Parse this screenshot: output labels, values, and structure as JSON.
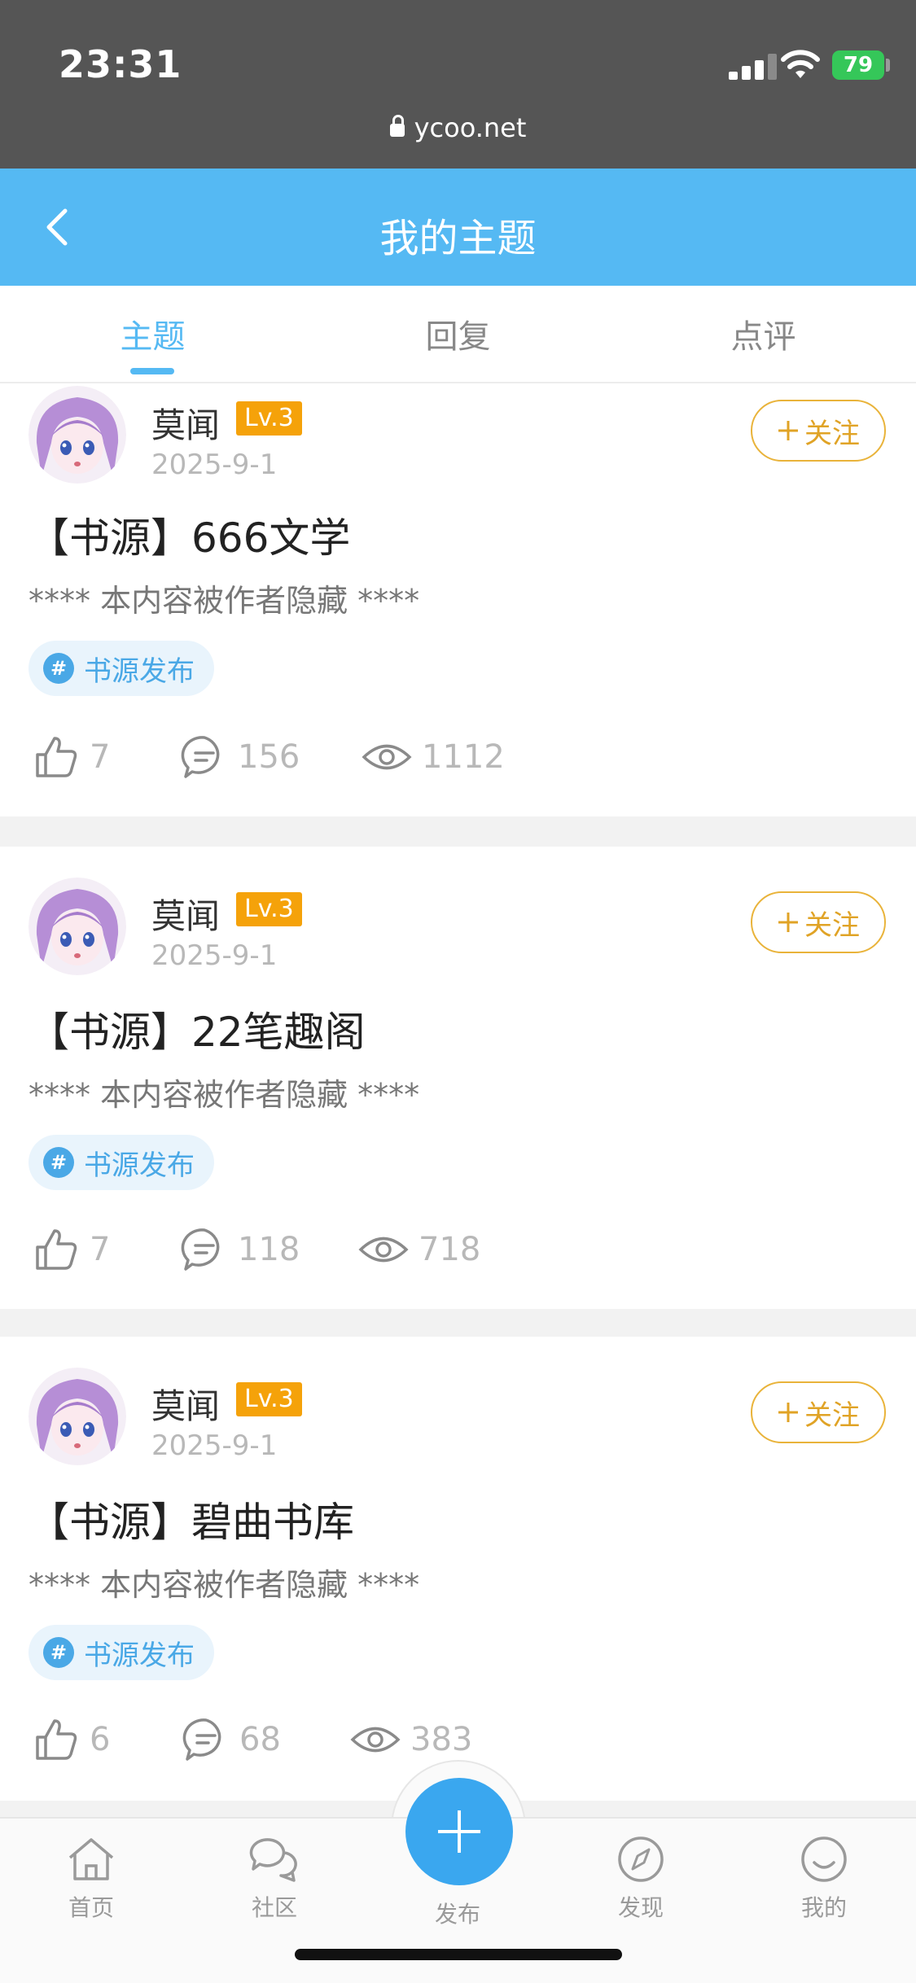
{
  "status_bar": {
    "time": "23:31",
    "battery": "79",
    "url": "ycoo.net"
  },
  "nav": {
    "title": "我的主题",
    "back_icon": "chevron-left-icon"
  },
  "tabs": [
    {
      "label": "主题",
      "active": true
    },
    {
      "label": "回复",
      "active": false
    },
    {
      "label": "点评",
      "active": false
    }
  ],
  "posts": [
    {
      "username": "莫闻",
      "level": "Lv.3",
      "date": "2025-9-1",
      "follow_label": "关注",
      "title": "【书源】666文学",
      "excerpt": "**** 本内容被作者隐藏 ****",
      "tag": "书源发布",
      "likes": "7",
      "comments": "156",
      "views": "1112"
    },
    {
      "username": "莫闻",
      "level": "Lv.3",
      "date": "2025-9-1",
      "follow_label": "关注",
      "title": "【书源】22笔趣阁",
      "excerpt": "**** 本内容被作者隐藏 ****",
      "tag": "书源发布",
      "likes": "7",
      "comments": "118",
      "views": "718"
    },
    {
      "username": "莫闻",
      "level": "Lv.3",
      "date": "2025-9-1",
      "follow_label": "关注",
      "title": "【书源】碧曲书库",
      "excerpt": "**** 本内容被作者隐藏 ****",
      "tag": "书源发布",
      "likes": "6",
      "comments": "68",
      "views": "383"
    }
  ],
  "tabbar": {
    "home": "首页",
    "community": "社区",
    "publish": "发布",
    "discover": "发现",
    "mine": "我的"
  },
  "colors": {
    "primary": "#55b9f3",
    "level_badge": "#f5a20a",
    "follow": "#e0a326",
    "tag_bg": "#e9f4fc"
  }
}
